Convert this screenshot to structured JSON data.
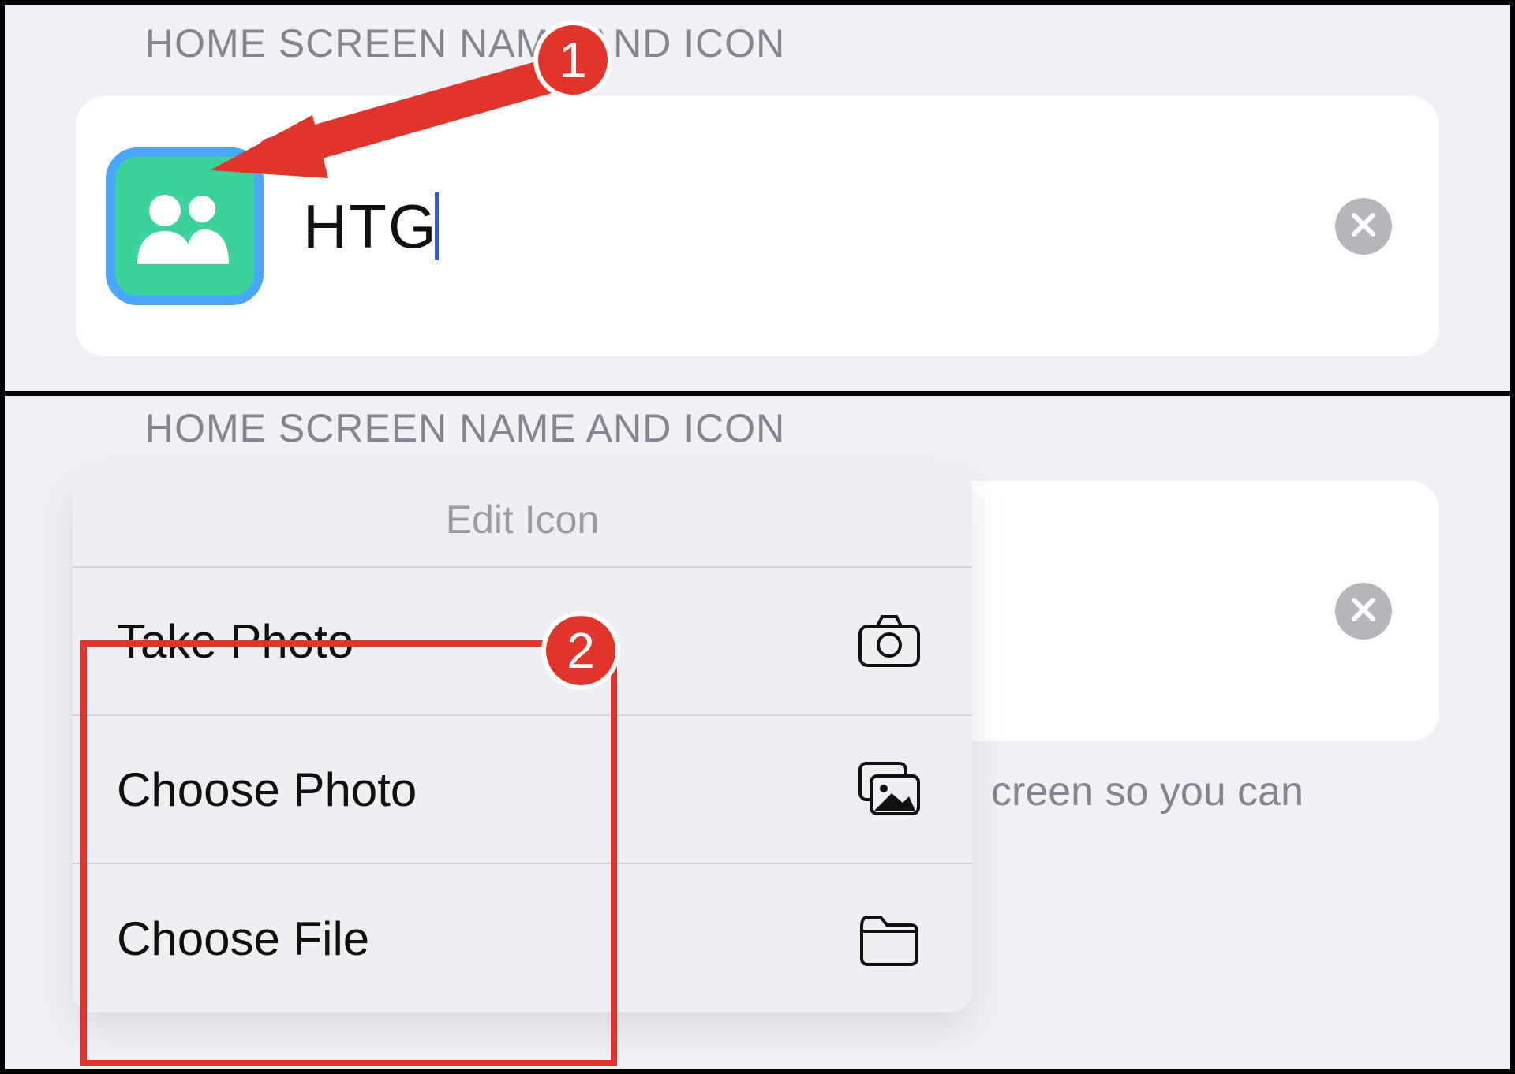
{
  "top": {
    "section_header": "HOME SCREEN NAME AND ICON",
    "shortcut_name": "HTG",
    "icon_name": "people-icon",
    "clear_label": "clear"
  },
  "bottom": {
    "section_header": "HOME SCREEN NAME AND ICON",
    "popup_title": "Edit Icon",
    "menu": [
      {
        "label": "Take Photo",
        "icon": "camera-icon"
      },
      {
        "label": "Choose Photo",
        "icon": "photos-icon"
      },
      {
        "label": "Choose File",
        "icon": "folder-icon"
      }
    ],
    "help_fragment": "creen so you can"
  },
  "annotations": {
    "badge1": "1",
    "badge2": "2"
  },
  "colors": {
    "accent_red": "#e1352b",
    "icon_green": "#3bd39b",
    "selection_blue": "#4aa7ff"
  }
}
